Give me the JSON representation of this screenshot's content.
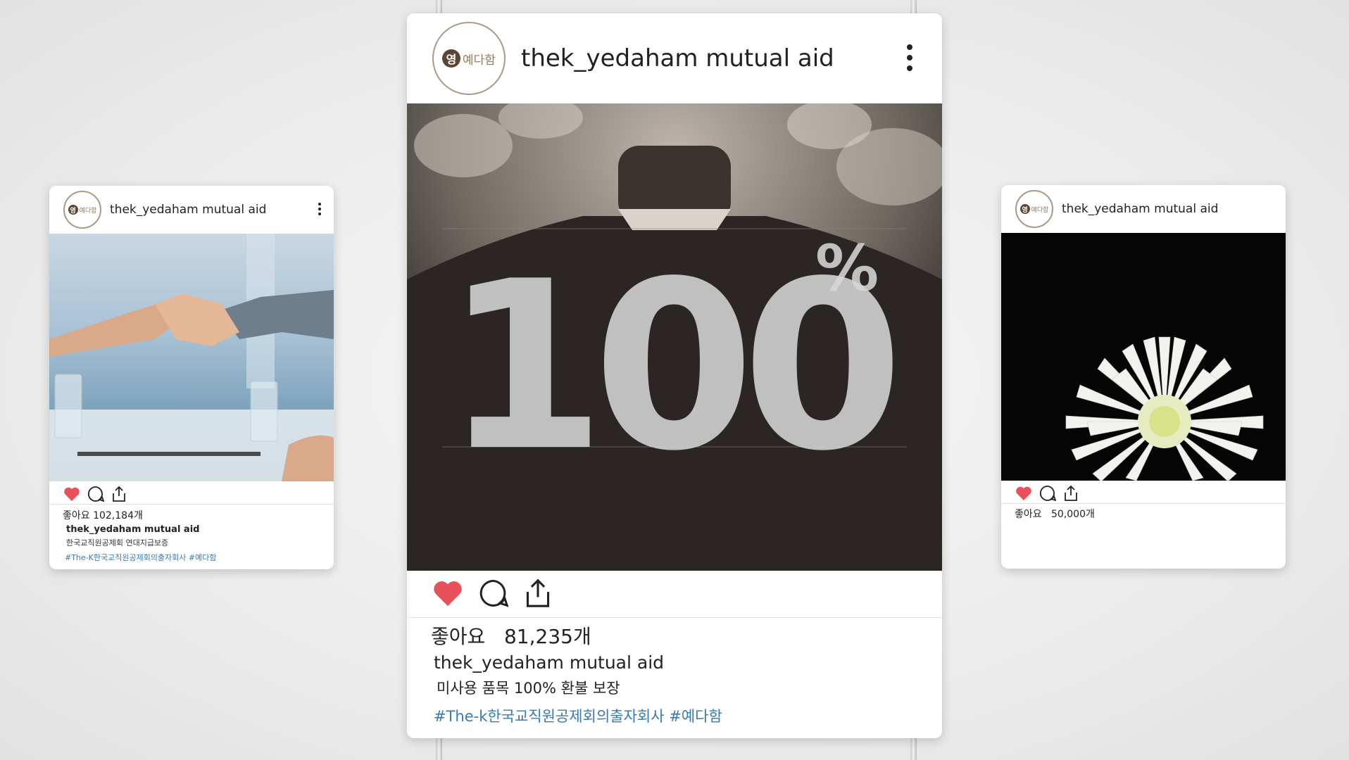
{
  "brand": {
    "seal": "영",
    "wordmark": "예다함"
  },
  "colors": {
    "heart": "#e8505b",
    "hashtag": "#3a7ab0",
    "frame_border": "#a89a8a"
  },
  "icons": [
    "heart-icon",
    "comment-icon",
    "share-icon",
    "more-icon"
  ],
  "left_post": {
    "username": "thek_yedaham mutual aid",
    "likes": "좋아요 102,184개",
    "caption_user": "thek_yedaham mutual aid",
    "caption_text": "한국교직원공제회 연대지급보증",
    "hashtags": "#The-K한국교직원공제회의출자회사 #예다함"
  },
  "center_post": {
    "username": "thek_yedaham mutual aid",
    "big_number": "100",
    "percent": "%",
    "likes": "좋아요   81,235개",
    "caption_user": "thek_yedaham mutual aid",
    "caption_text": "미사용 품목 100% 환불 보장",
    "hashtags": "#The-k한국교직원공제회의출자회사 #예다함"
  },
  "right_post": {
    "username": "thek_yedaham mutual aid",
    "likes": "좋아요   50,000개"
  }
}
